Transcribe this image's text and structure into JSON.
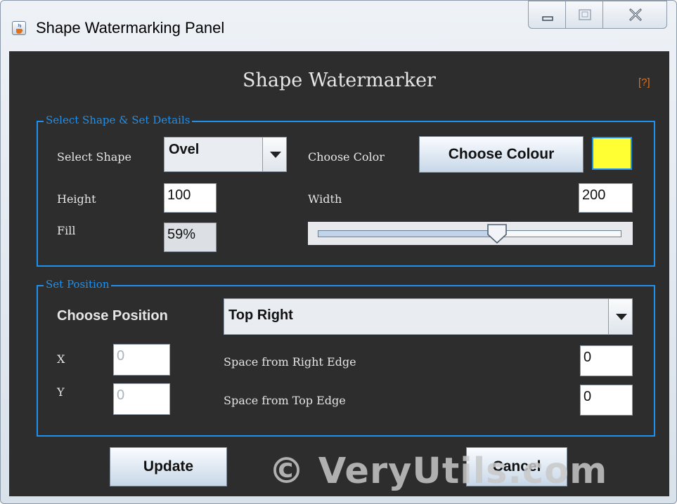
{
  "window": {
    "title": "Shape Watermarking Panel",
    "icon": "java-cup-icon"
  },
  "panel": {
    "heading": "Shape Watermarker",
    "help_label": "[?]"
  },
  "shape_group": {
    "legend": "Select Shape & Set Details",
    "select_shape_label": "Select Shape",
    "shape_value": "Ovel",
    "choose_color_label": "Choose Color",
    "choose_colour_button": "Choose Colour",
    "selected_color": "#ffff33",
    "height_label": "Height",
    "height_value": "100",
    "width_label": "Width",
    "width_value": "200",
    "fill_label": "Fill",
    "fill_value": "59%",
    "fill_fraction": 0.59
  },
  "position_group": {
    "legend": "Set Position",
    "choose_position_label": "Choose Position",
    "position_value": "Top Right",
    "x_label": "X",
    "x_value": "0",
    "y_label": "Y",
    "y_value": "0",
    "right_edge_label": "Space from Right Edge",
    "right_edge_value": "0",
    "top_edge_label": "Space from Top Edge",
    "top_edge_value": "0"
  },
  "actions": {
    "update_label": "Update",
    "cancel_label": "Cancel"
  },
  "watermark": {
    "text": "© VeryUtils.com"
  },
  "colors": {
    "panel_bg": "#2d2d2d",
    "accent": "#1f90ec",
    "help_link": "#e2701a"
  }
}
